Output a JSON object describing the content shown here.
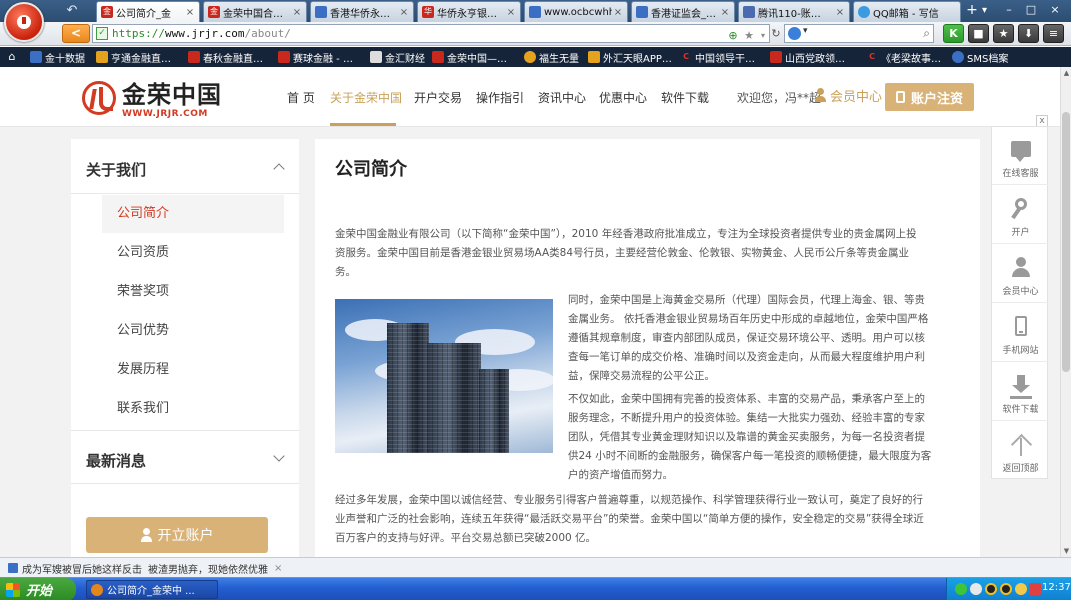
{
  "browser": {
    "tabs": [
      {
        "label": "公司简介_金",
        "icon": "jrjr-icon",
        "active": true
      },
      {
        "label": "金荣中国合…",
        "icon": "jrjr-icon",
        "active": false
      },
      {
        "label": "香港华侨永…",
        "icon": "generic-page-icon",
        "active": false
      },
      {
        "label": "华侨永亨银…",
        "icon": "bank-icon",
        "active": false
      },
      {
        "label": "www.ocbcwhh…",
        "icon": "generic-page-icon",
        "active": false
      },
      {
        "label": "香港证监会_…",
        "icon": "generic-page-icon",
        "active": false
      },
      {
        "label": "腾讯110-账…",
        "icon": "shield-icon",
        "active": false
      },
      {
        "label": "QQ邮箱 - 写信",
        "icon": "qq-icon",
        "active": false
      }
    ],
    "new_tab": "+",
    "url": {
      "protocol": "https://",
      "host": "www.jrjr.com",
      "path": "/about/"
    },
    "bookmarks": [
      {
        "label": "金十数据",
        "icon": "bookmark-icon"
      },
      {
        "label": "亨通金融直…",
        "icon": "bookmark-icon"
      },
      {
        "label": "春秋金融直…",
        "icon": "bookmark-icon"
      },
      {
        "label": "赛球金融 - …",
        "icon": "bookmark-icon"
      },
      {
        "label": "金汇财经",
        "icon": "bookmark-icon"
      },
      {
        "label": "金荣中国—…",
        "icon": "bookmark-icon"
      },
      {
        "label": "福生无量",
        "icon": "bookmark-icon"
      },
      {
        "label": "外汇天眼APP…",
        "icon": "bookmark-icon"
      },
      {
        "label": "中国领导干…",
        "icon": "bookmark-icon"
      },
      {
        "label": "山西党政领…",
        "icon": "bookmark-icon"
      },
      {
        "label": "《老梁故事…",
        "icon": "bookmark-icon"
      },
      {
        "label": "SMS档案",
        "icon": "bookmark-icon"
      }
    ]
  },
  "site": {
    "logo_name": "金荣中国",
    "logo_domain": "WWW.JRJR.COM",
    "nav": [
      {
        "label": "首 页",
        "active": false
      },
      {
        "label": "关于金荣中国",
        "active": true
      },
      {
        "label": "开户交易",
        "active": false
      },
      {
        "label": "操作指引",
        "active": false
      },
      {
        "label": "资讯中心",
        "active": false
      },
      {
        "label": "优惠中心",
        "active": false
      },
      {
        "label": "软件下载",
        "active": false
      }
    ],
    "welcome": "欢迎您，冯**超",
    "member_center": "会员中心",
    "register": "账户注资"
  },
  "sidebar": {
    "section_about": "关于我们",
    "items": [
      {
        "label": "公司简介",
        "active": true
      },
      {
        "label": "公司资质",
        "active": false
      },
      {
        "label": "荣誉奖项",
        "active": false
      },
      {
        "label": "公司优势",
        "active": false
      },
      {
        "label": "发展历程",
        "active": false
      },
      {
        "label": "联系我们",
        "active": false
      }
    ],
    "section_news": "最新消息",
    "open_account": "开立账户"
  },
  "content": {
    "title": "公司简介",
    "para1_line1": "金荣中国金融业有限公司（以下简称“金荣中国”），2010 年经香港政府批准成立，专注为全球投资者提供专业的贵金属网上投",
    "para1_line2": "资服务。金荣中国目前是香港金银业贸易场AA类84号行员，主要经营伦敦金、伦敦银、实物黄金、人民币公斤条等贵金属业",
    "para1_line3": "务。",
    "para2_lines": [
      "同时，金荣中国是上海黄金交易所（代理）国际会员，代理上海金、银、等贵",
      "金属业务。 依托香港金银业贸易场百年历史中形成的卓越地位，金荣中国严格",
      "遵循其规章制度，审查内部团队成员，保证交易环境公平、透明。用户可以核",
      "查每一笔订单的成交价格、准确时间以及资金走向，从而最大程度维护用户利",
      "益，保障交易流程的公平公正。"
    ],
    "para3_lines": [
      "不仅如此，金荣中国拥有完善的投资体系、丰富的交易产品，秉承客户至上的",
      "服务理念，不断提升用户的投资体验。集结一大批实力强劲、经验丰富的专家",
      "团队，凭借其专业黄金理财知识以及靠谱的黄金买卖服务，为每一名投资者提",
      "供24 小时不间断的金融服务，确保客户每一笔投资的顺畅便捷，最大限度为客",
      "户的资产增值而努力。"
    ],
    "para4_lines": [
      "经过多年发展，金荣中国以诚信经营、专业服务引得客户普遍尊重，以规范操作、科学管理获得行业一致认可，奠定了良好的行",
      "业声誉和广泛的社会影响，连续五年获得“最活跃交易平台”的荣誉。金荣中国以“简单方便的操作，安全稳定的交易”获得全球近",
      "百万客户的支持与好评。平台交易总额已突破2000 亿。"
    ]
  },
  "float_panel": {
    "close": "x",
    "items": [
      {
        "label": "在线客服",
        "icon": "chat-icon"
      },
      {
        "label": "开户",
        "icon": "key-icon"
      },
      {
        "label": "会员中心",
        "icon": "user-icon"
      },
      {
        "label": "手机网站",
        "icon": "phone-icon"
      },
      {
        "label": "软件下载",
        "icon": "download-icon"
      },
      {
        "label": "返回顶部",
        "icon": "arrow-up-icon"
      }
    ]
  },
  "statusbar": {
    "news1": "成为军嫂被冒后她这样反击",
    "news2": "被渣男抛弃，现她依然优雅"
  },
  "taskbar": {
    "start": "开始",
    "task": "公司简介_金荣中 ...",
    "clock": "12:37"
  }
}
